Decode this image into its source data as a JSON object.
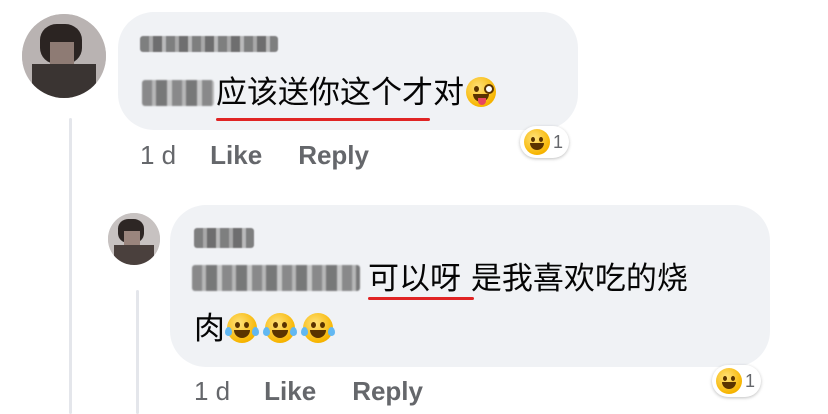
{
  "comments": [
    {
      "author": "Kuo Gwei",
      "tagged_name": "Kuo",
      "text": "应该送你这个才对",
      "time": "1 d",
      "like_label": "Like",
      "reply_label": "Reply",
      "reaction_count": "1",
      "reaction_icon": "laughing-emoji"
    },
    {
      "author": "强哥",
      "tagged_name": "Kuo Gwei",
      "text_line1": "可以呀 是我喜欢吃的烧",
      "text_line2": "肉",
      "time": "1 d",
      "like_label": "Like",
      "reply_label": "Reply",
      "reaction_count": "1",
      "reaction_icon": "laughing-emoji"
    }
  ],
  "colors": {
    "bubble": "#f0f2f5",
    "meta_text": "#65676b",
    "underline": "#e02424"
  }
}
